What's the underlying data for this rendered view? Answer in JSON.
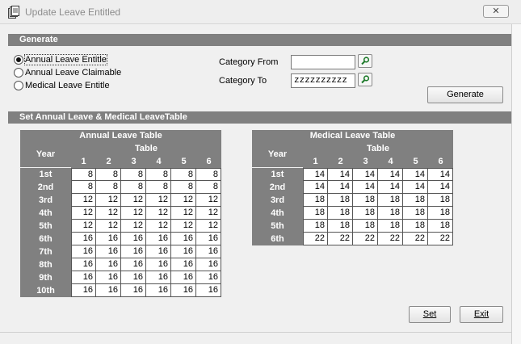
{
  "window": {
    "title": "Update Leave Entitled",
    "close_symbol": "✕",
    "app_icon": "document-stack-icon"
  },
  "generate_section": {
    "header": "Generate",
    "radios": [
      {
        "label": "Annual Leave Entitle",
        "checked": true
      },
      {
        "label": "Annual Leave Claimable",
        "checked": false
      },
      {
        "label": "Medical Leave Entitle",
        "checked": false
      }
    ],
    "category_from_label": "Category From",
    "category_from_value": "",
    "category_to_label": "Category To",
    "category_to_value": "zzzzzzzzzz",
    "generate_button": "Generate",
    "lookup_icon": "search-icon"
  },
  "set_section": {
    "header": "Set Annual Leave & Medical LeaveTable"
  },
  "annual_table": {
    "title": "Annual Leave Table",
    "year_header": "Year",
    "table_header": "Table",
    "columns": [
      "1",
      "2",
      "3",
      "4",
      "5",
      "6"
    ],
    "rows": [
      {
        "year": "1st",
        "values": [
          "8",
          "8",
          "8",
          "8",
          "8",
          "8"
        ]
      },
      {
        "year": "2nd",
        "values": [
          "8",
          "8",
          "8",
          "8",
          "8",
          "8"
        ]
      },
      {
        "year": "3rd",
        "values": [
          "12",
          "12",
          "12",
          "12",
          "12",
          "12"
        ]
      },
      {
        "year": "4th",
        "values": [
          "12",
          "12",
          "12",
          "12",
          "12",
          "12"
        ]
      },
      {
        "year": "5th",
        "values": [
          "12",
          "12",
          "12",
          "12",
          "12",
          "12"
        ]
      },
      {
        "year": "6th",
        "values": [
          "16",
          "16",
          "16",
          "16",
          "16",
          "16"
        ]
      },
      {
        "year": "7th",
        "values": [
          "16",
          "16",
          "16",
          "16",
          "16",
          "16"
        ]
      },
      {
        "year": "8th",
        "values": [
          "16",
          "16",
          "16",
          "16",
          "16",
          "16"
        ]
      },
      {
        "year": "9th",
        "values": [
          "16",
          "16",
          "16",
          "16",
          "16",
          "16"
        ]
      },
      {
        "year": "10th",
        "values": [
          "16",
          "16",
          "16",
          "16",
          "16",
          "16"
        ]
      }
    ]
  },
  "medical_table": {
    "title": "Medical Leave Table",
    "year_header": "Year",
    "table_header": "Table",
    "columns": [
      "1",
      "2",
      "3",
      "4",
      "5",
      "6"
    ],
    "rows": [
      {
        "year": "1st",
        "values": [
          "14",
          "14",
          "14",
          "14",
          "14",
          "14"
        ]
      },
      {
        "year": "2nd",
        "values": [
          "14",
          "14",
          "14",
          "14",
          "14",
          "14"
        ]
      },
      {
        "year": "3rd",
        "values": [
          "18",
          "18",
          "18",
          "18",
          "18",
          "18"
        ]
      },
      {
        "year": "4th",
        "values": [
          "18",
          "18",
          "18",
          "18",
          "18",
          "18"
        ]
      },
      {
        "year": "5th",
        "values": [
          "18",
          "18",
          "18",
          "18",
          "18",
          "18"
        ]
      },
      {
        "year": "6th",
        "values": [
          "22",
          "22",
          "22",
          "22",
          "22",
          "22"
        ]
      }
    ]
  },
  "footer": {
    "set_button": "Set",
    "exit_button": "Exit"
  }
}
